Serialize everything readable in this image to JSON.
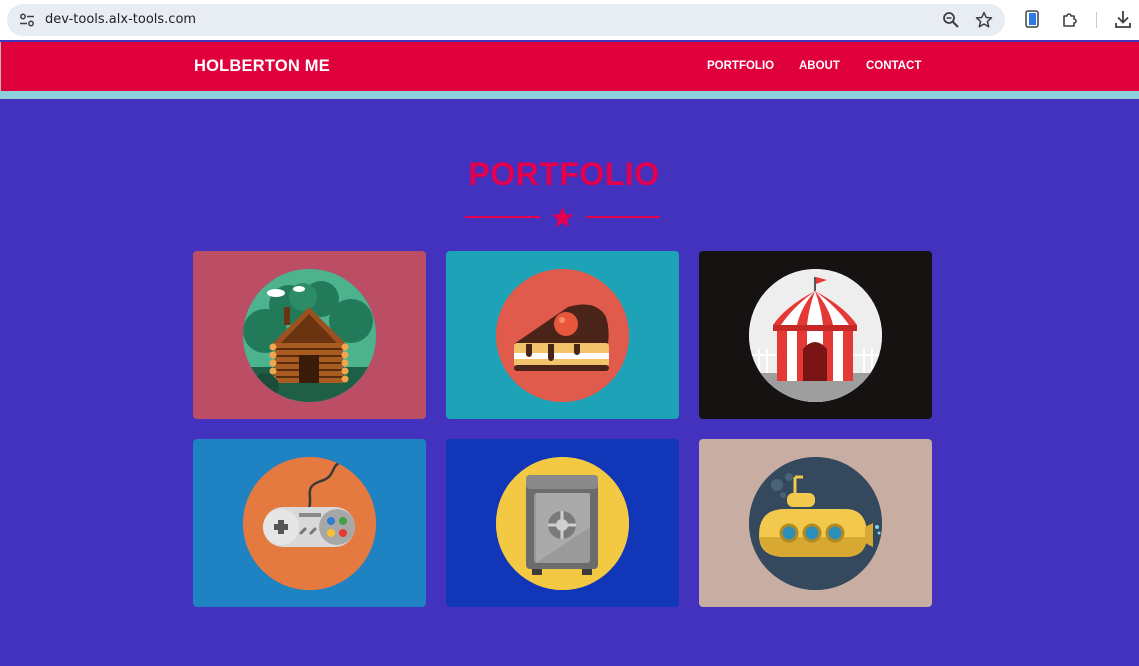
{
  "browser": {
    "url": "dev-tools.alx-tools.com"
  },
  "header": {
    "logo": "HOLBERTON ME",
    "nav": [
      "PORTFOLIO",
      "ABOUT",
      "CONTACT"
    ]
  },
  "section": {
    "title": "PORTFOLIO"
  },
  "colors": {
    "header_red": "#e0003b",
    "page_bg": "#4232bd",
    "stripe": "#8dd0dc",
    "title": "#e4004f"
  },
  "portfolio_items": [
    {
      "icon": "log-cabin-icon",
      "card_color": "#bb4e65",
      "circle_color": "#2f9f80"
    },
    {
      "icon": "cake-slice-icon",
      "card_color": "#1ea2b8",
      "circle_color": "#e05b4b"
    },
    {
      "icon": "circus-tent-icon",
      "card_color": "#161211",
      "circle_color": "#eeeeee"
    },
    {
      "icon": "game-controller-icon",
      "card_color": "#1f82c2",
      "circle_color": "#e47a3f"
    },
    {
      "icon": "safe-icon",
      "card_color": "#1137b8",
      "circle_color": "#f3c842"
    },
    {
      "icon": "submarine-icon",
      "card_color": "#c7ada2",
      "circle_color": "#34495e"
    }
  ]
}
